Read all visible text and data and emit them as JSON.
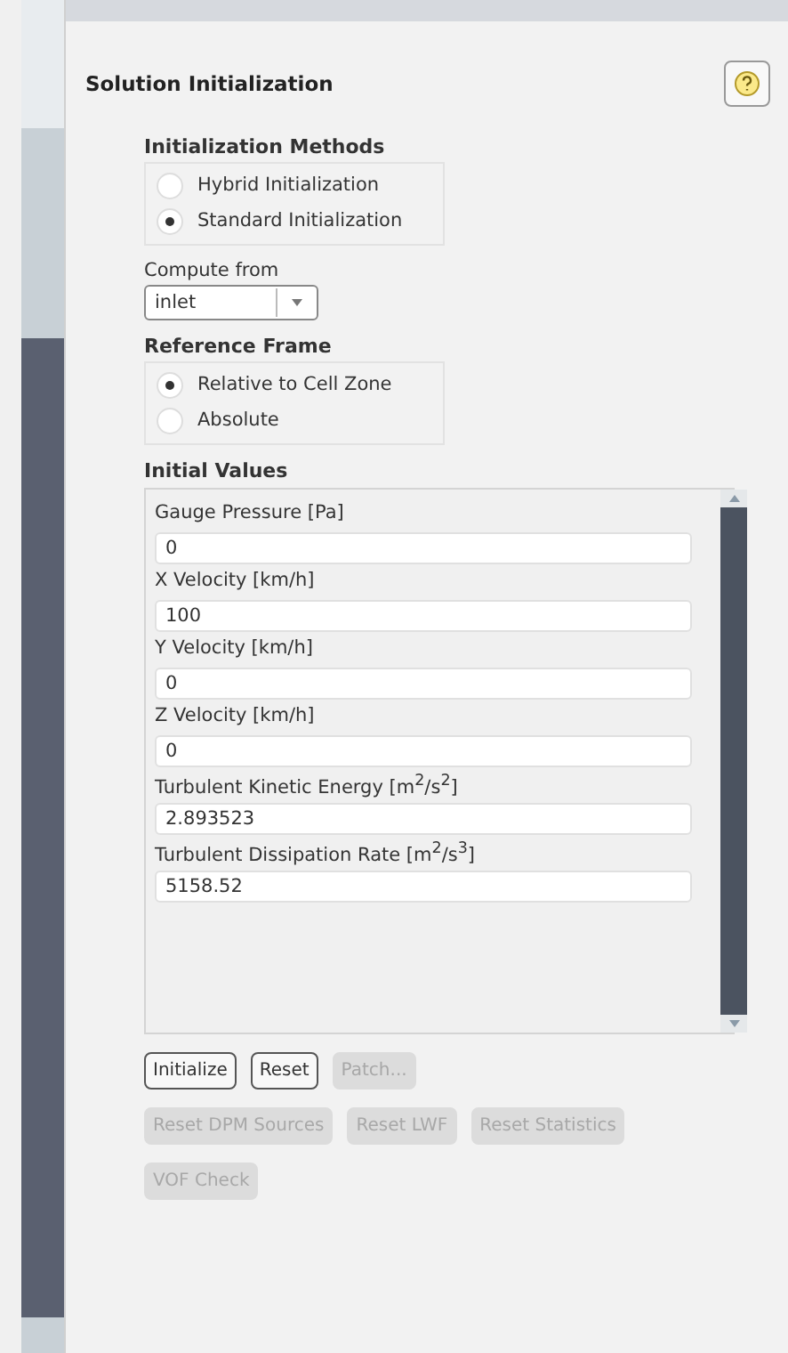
{
  "panel": {
    "title": "Solution Initialization"
  },
  "initialization_methods": {
    "label": "Initialization Methods",
    "options": [
      {
        "label": "Hybrid  Initialization",
        "selected": false
      },
      {
        "label": "Standard Initialization",
        "selected": true
      }
    ]
  },
  "compute_from": {
    "label": "Compute from",
    "value": "inlet"
  },
  "reference_frame": {
    "label": "Reference Frame",
    "options": [
      {
        "label": "Relative to Cell Zone",
        "selected": true
      },
      {
        "label": "Absolute",
        "selected": false
      }
    ]
  },
  "initial_values": {
    "label": "Initial Values",
    "fields": [
      {
        "label": "Gauge Pressure [Pa]",
        "value": "0"
      },
      {
        "label": "X Velocity [km/h]",
        "value": "100"
      },
      {
        "label": "Y Velocity [km/h]",
        "value": "0"
      },
      {
        "label": "Z Velocity [km/h]",
        "value": "0"
      },
      {
        "label": "Turbulent Kinetic Energy [m$^{2}$/s$^{2}$]",
        "value": "2.893523"
      },
      {
        "label": "Turbulent Dissipation Rate [m$^{2}$/s$^{3}$]",
        "value": "5158.52"
      }
    ]
  },
  "button_rows": [
    [
      {
        "label": "Initialize",
        "disabled": false
      },
      {
        "label": "Reset",
        "disabled": false
      },
      {
        "label": "Patch...",
        "disabled": true
      }
    ],
    [
      {
        "label": "Reset DPM Sources",
        "disabled": true
      },
      {
        "label": "Reset LWF",
        "disabled": true
      },
      {
        "label": "Reset Statistics",
        "disabled": true
      }
    ],
    [
      {
        "label": "VOF Check",
        "disabled": true
      }
    ]
  ]
}
